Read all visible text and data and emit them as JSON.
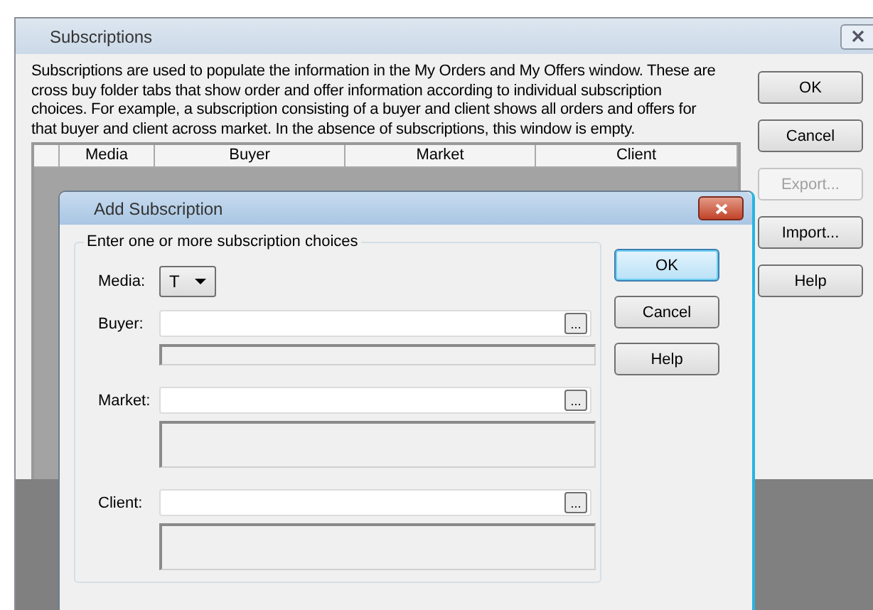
{
  "main_window": {
    "title": "Subscriptions",
    "description_lines": [
      "Subscriptions are used to populate the information in the My Orders and My Offers window. These are",
      "cross buy folder tabs that show order and offer information according to individual subscription",
      "choices. For example, a subscription consisting of a buyer and client shows all orders and offers for",
      "that buyer and client across market. In the absence of subscriptions, this window is empty."
    ],
    "table": {
      "columns": [
        "Media",
        "Buyer",
        "Market",
        "Client"
      ]
    },
    "buttons": [
      {
        "label": "OK",
        "disabled": false
      },
      {
        "label": "Cancel",
        "disabled": false
      },
      {
        "label": "Export...",
        "disabled": true
      },
      {
        "label": "Import...",
        "disabled": false
      },
      {
        "label": "Help",
        "disabled": false
      }
    ]
  },
  "dialog": {
    "title": "Add Subscription",
    "group_label": "Enter one or more subscription choices",
    "media": {
      "label": "Media:",
      "value": "T"
    },
    "fields": [
      {
        "label": "Buyer:",
        "browse": "...",
        "kind": "single"
      },
      {
        "label": "Market:",
        "browse": "...",
        "kind": "multi"
      },
      {
        "label": "Client:",
        "browse": "...",
        "kind": "multi"
      }
    ],
    "buttons": [
      {
        "label": "OK",
        "default": true
      },
      {
        "label": "Cancel",
        "default": false
      },
      {
        "label": "Help",
        "default": false
      }
    ]
  }
}
